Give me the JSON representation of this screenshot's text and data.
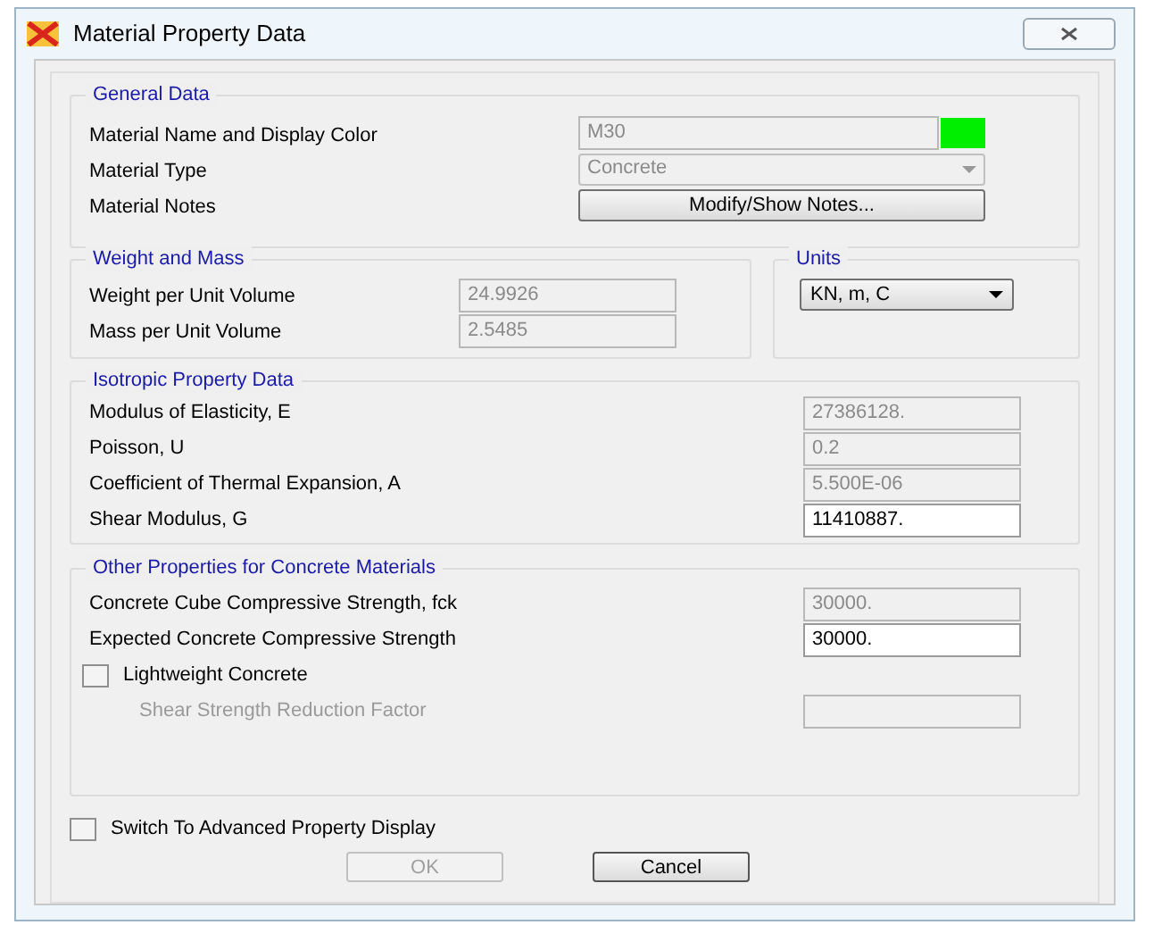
{
  "window": {
    "title": "Material Property Data"
  },
  "general": {
    "title": "General Data",
    "rows": [
      {
        "label": "Material Name and Display Color",
        "kind": "text",
        "value": "M30",
        "disabled": true,
        "color": "#00ee00"
      },
      {
        "label": "Material Type",
        "kind": "dropdown",
        "value": "Concrete",
        "disabled": true
      },
      {
        "label": "Material Notes",
        "kind": "button",
        "value": "Modify/Show Notes..."
      }
    ]
  },
  "weight": {
    "title": "Weight and Mass",
    "rows": [
      {
        "label": "Weight per Unit Volume",
        "value": "24.9926",
        "disabled": true
      },
      {
        "label": "Mass per Unit Volume",
        "value": "2.5485",
        "disabled": true
      }
    ]
  },
  "units": {
    "title": "Units",
    "value": "KN, m, C"
  },
  "isotropic": {
    "title": "Isotropic Property Data",
    "rows": [
      {
        "label": "Modulus of Elasticity,  E",
        "value": "27386128.",
        "disabled": true
      },
      {
        "label": "Poisson, U",
        "value": "0.2",
        "disabled": true
      },
      {
        "label": "Coefficient of Thermal Expansion,  A",
        "value": "5.500E-06",
        "disabled": true
      },
      {
        "label": "Shear Modulus,  G",
        "value": "11410887.",
        "disabled": false
      }
    ]
  },
  "concrete": {
    "title": "Other Properties for Concrete Materials",
    "rows": [
      {
        "label": "Concrete Cube Compressive Strength, fck",
        "value": "30000.",
        "disabled": true
      },
      {
        "label": "Expected Concrete Compressive Strength",
        "value": "30000.",
        "disabled": false
      }
    ],
    "lightweight": {
      "label": "Lightweight Concrete",
      "checked": false
    },
    "reduction": {
      "label": "Shear Strength Reduction Factor",
      "disabled": true
    }
  },
  "advanced": {
    "label": "Switch To Advanced Property Display",
    "checked": false
  },
  "buttons": [
    {
      "label": "OK",
      "disabled": true
    },
    {
      "label": "Cancel",
      "disabled": false
    }
  ]
}
